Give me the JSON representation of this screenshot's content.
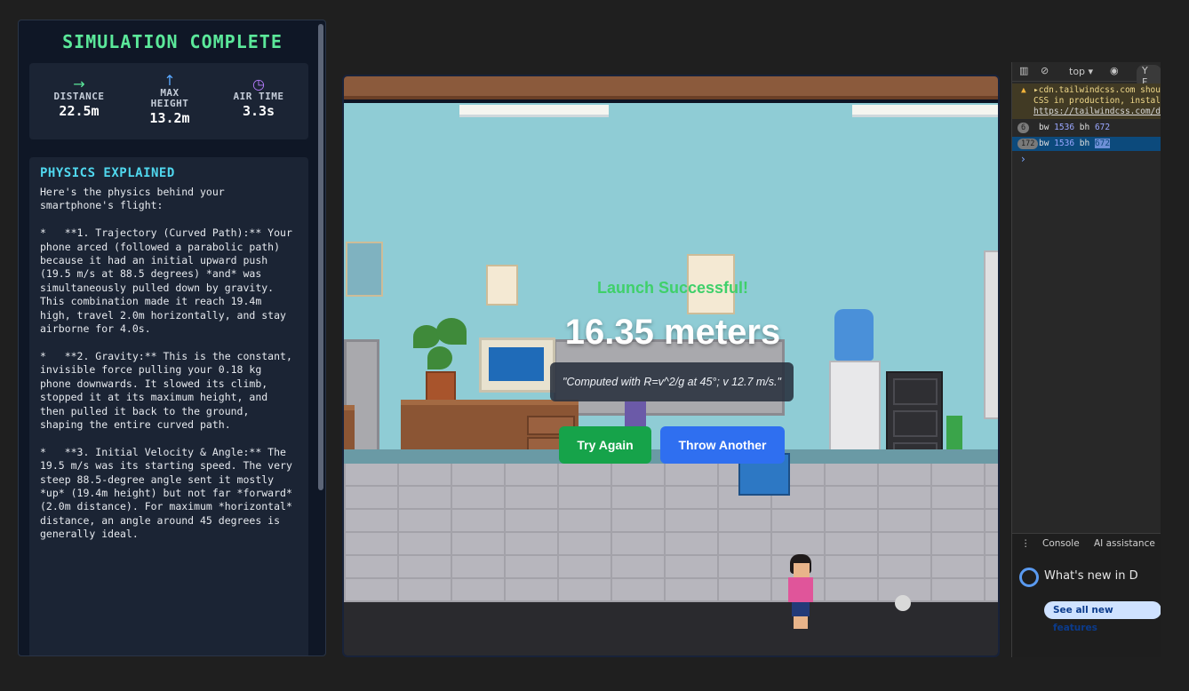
{
  "left_panel": {
    "title": "SIMULATION COMPLETE",
    "stats": [
      {
        "icon": "arrow-right-icon",
        "glyph": "→",
        "color": "#5be89a",
        "label": "DISTANCE",
        "value": "22.5m"
      },
      {
        "icon": "arrow-up-icon",
        "glyph": "↑",
        "color": "#5aa9ff",
        "label": "MAX HEIGHT",
        "value": "13.2m"
      },
      {
        "icon": "clock-icon",
        "glyph": "◷",
        "color": "#b77cff",
        "label": "AIR TIME",
        "value": "3.3s"
      }
    ],
    "physics_title": "PHYSICS EXPLAINED",
    "physics_text": "Here's the physics behind your smartphone's flight:\n\n*   **1. Trajectory (Curved Path):** Your phone arced (followed a parabolic path) because it had an initial upward push (19.5 m/s at 88.5 degrees) *and* was simultaneously pulled down by gravity. This combination made it reach 19.4m high, travel 2.0m horizontally, and stay airborne for 4.0s.\n\n*   **2. Gravity:** This is the constant, invisible force pulling your 0.18 kg phone downwards. It slowed its climb, stopped it at its maximum height, and then pulled it back to the ground, shaping the entire curved path.\n\n*   **3. Initial Velocity & Angle:** The 19.5 m/s was its starting speed. The very steep 88.5-degree angle sent it mostly *up* (19.4m height) but not far *forward* (2.0m distance). For maximum *horizontal* distance, an angle around 45 degrees is generally ideal."
  },
  "game": {
    "result_title": "Launch Successful!",
    "result_value": "16.35 meters",
    "result_note": "\"Computed with R=v^2/g at 45°; v 12.7 m/s.\"",
    "buttons": {
      "try_again": "Try Again",
      "throw_another": "Throw Another"
    }
  },
  "devtools": {
    "context": "top ▾",
    "filter_label": "Y F",
    "warning": "▸cdn.tailwindcss.com should not be used in production, instal",
    "warning_line2": "CSS in production, instal",
    "warning_link": "https://tailwindcss.com/d",
    "rows": [
      {
        "count": "6",
        "text": "bw ",
        "n1": "1536",
        "mid": " bh ",
        "n2": "672"
      },
      {
        "count": "172",
        "text": "bw ",
        "n1": "1536",
        "mid": " bh ",
        "n2": "672"
      }
    ],
    "prompt": "›",
    "tabs": {
      "console": "Console",
      "ai": "AI assistance"
    },
    "news": "What's new in D",
    "see_all": "See all new features"
  }
}
